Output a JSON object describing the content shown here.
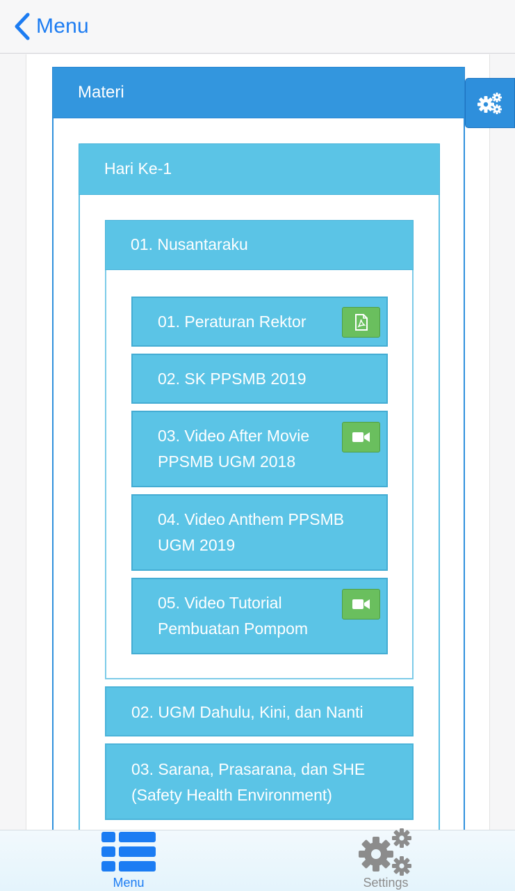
{
  "nav": {
    "back_label": "Menu"
  },
  "panel": {
    "title": "Materi"
  },
  "day": {
    "title": "Hari Ke-1"
  },
  "topics": [
    {
      "title": "01. Nusantaraku",
      "items": [
        {
          "title": "01. Peraturan Rektor",
          "badge_icon": "pdf-icon"
        },
        {
          "title": "02. SK PPSMB 2019",
          "badge_icon": ""
        },
        {
          "title": "03. Video After Movie PPSMB UGM 2018",
          "badge_icon": "video-camera-icon"
        },
        {
          "title": "04. Video Anthem PPSMB UGM 2019",
          "badge_icon": ""
        },
        {
          "title": "05. Video Tutorial Pembuatan Pompom",
          "badge_icon": "video-camera-icon"
        }
      ]
    },
    {
      "title": "02. UGM Dahulu, Kini, dan Nanti"
    },
    {
      "title": "03. Sarana, Prasarana, dan SHE (Safety Health Environment)"
    }
  ],
  "tabs": [
    {
      "label": "Menu",
      "icon": "list-icon",
      "active": true
    },
    {
      "label": "Settings",
      "icon": "gears-icon",
      "active": false
    }
  ],
  "colors": {
    "ios_blue": "#1c7cf2",
    "panel_primary": "#3396de",
    "panel_info": "#5bc4e6",
    "badge_green": "#6abf5e"
  }
}
